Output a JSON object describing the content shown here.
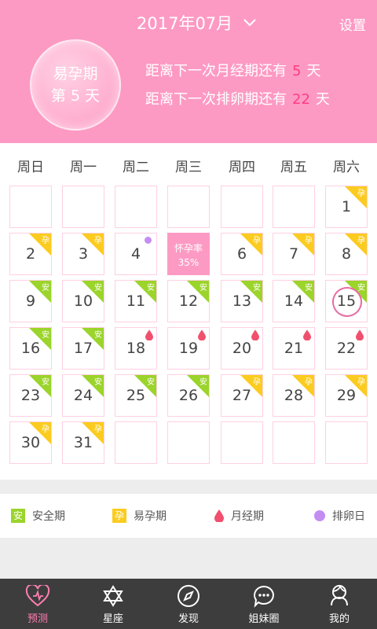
{
  "header": {
    "month": "2017年07月",
    "settings": "设置",
    "phase_line1": "易孕期",
    "phase_line2": "第 5 天",
    "period_prefix": "距离下一次月经期还有",
    "period_days": "5",
    "period_suffix": "天",
    "ovulation_prefix": "距离下一次排卵期还有",
    "ovulation_days": "22",
    "ovulation_suffix": "天"
  },
  "colors": {
    "header_bg": "#fd9ac4",
    "accent": "#ff3d7f",
    "safe": "#9bd42b",
    "fertile": "#fbcc1f",
    "period": "#f0506e",
    "ovulation": "#c48df2"
  },
  "calendar": {
    "weekdays": [
      "周日",
      "周一",
      "周二",
      "周三",
      "周四",
      "周五",
      "周六"
    ],
    "marks": {
      "yun": "孕",
      "an": "安"
    },
    "days": [
      {
        "day": "",
        "type": "empty"
      },
      {
        "day": "",
        "type": "empty"
      },
      {
        "day": "",
        "type": "empty"
      },
      {
        "day": "",
        "type": "empty"
      },
      {
        "day": "",
        "type": "empty"
      },
      {
        "day": "",
        "type": "empty"
      },
      {
        "day": "1",
        "type": "yun"
      },
      {
        "day": "2",
        "type": "yun"
      },
      {
        "day": "3",
        "type": "yun"
      },
      {
        "day": "4",
        "type": "ovulation"
      },
      {
        "day": "",
        "type": "highlight",
        "line1": "怀孕率",
        "line2": "35%"
      },
      {
        "day": "6",
        "type": "yun"
      },
      {
        "day": "7",
        "type": "yun"
      },
      {
        "day": "8",
        "type": "yun"
      },
      {
        "day": "9",
        "type": "an"
      },
      {
        "day": "10",
        "type": "an"
      },
      {
        "day": "11",
        "type": "an"
      },
      {
        "day": "12",
        "type": "an"
      },
      {
        "day": "13",
        "type": "an"
      },
      {
        "day": "14",
        "type": "an"
      },
      {
        "day": "15",
        "type": "an",
        "today": true
      },
      {
        "day": "16",
        "type": "an"
      },
      {
        "day": "17",
        "type": "an"
      },
      {
        "day": "18",
        "type": "period"
      },
      {
        "day": "19",
        "type": "period"
      },
      {
        "day": "20",
        "type": "period"
      },
      {
        "day": "21",
        "type": "period"
      },
      {
        "day": "22",
        "type": "period"
      },
      {
        "day": "23",
        "type": "an"
      },
      {
        "day": "24",
        "type": "an"
      },
      {
        "day": "25",
        "type": "an"
      },
      {
        "day": "26",
        "type": "an"
      },
      {
        "day": "27",
        "type": "yun"
      },
      {
        "day": "28",
        "type": "yun"
      },
      {
        "day": "29",
        "type": "yun"
      },
      {
        "day": "30",
        "type": "yun"
      },
      {
        "day": "31",
        "type": "yun"
      },
      {
        "day": "",
        "type": "empty"
      },
      {
        "day": "",
        "type": "empty"
      },
      {
        "day": "",
        "type": "empty"
      },
      {
        "day": "",
        "type": "empty"
      },
      {
        "day": "",
        "type": "empty"
      }
    ]
  },
  "legend": {
    "safe_box": "安",
    "safe_label": "安全期",
    "fertile_box": "孕",
    "fertile_label": "易孕期",
    "period_label": "月经期",
    "ovulation_label": "排卵日"
  },
  "tabs": [
    {
      "label": "预测",
      "icon": "heart-pulse-icon",
      "active": true
    },
    {
      "label": "星座",
      "icon": "star-of-david-icon",
      "active": false
    },
    {
      "label": "发现",
      "icon": "compass-icon",
      "active": false
    },
    {
      "label": "姐妹圈",
      "icon": "chat-bubble-icon",
      "active": false
    },
    {
      "label": "我的",
      "icon": "profile-icon",
      "active": false
    }
  ]
}
